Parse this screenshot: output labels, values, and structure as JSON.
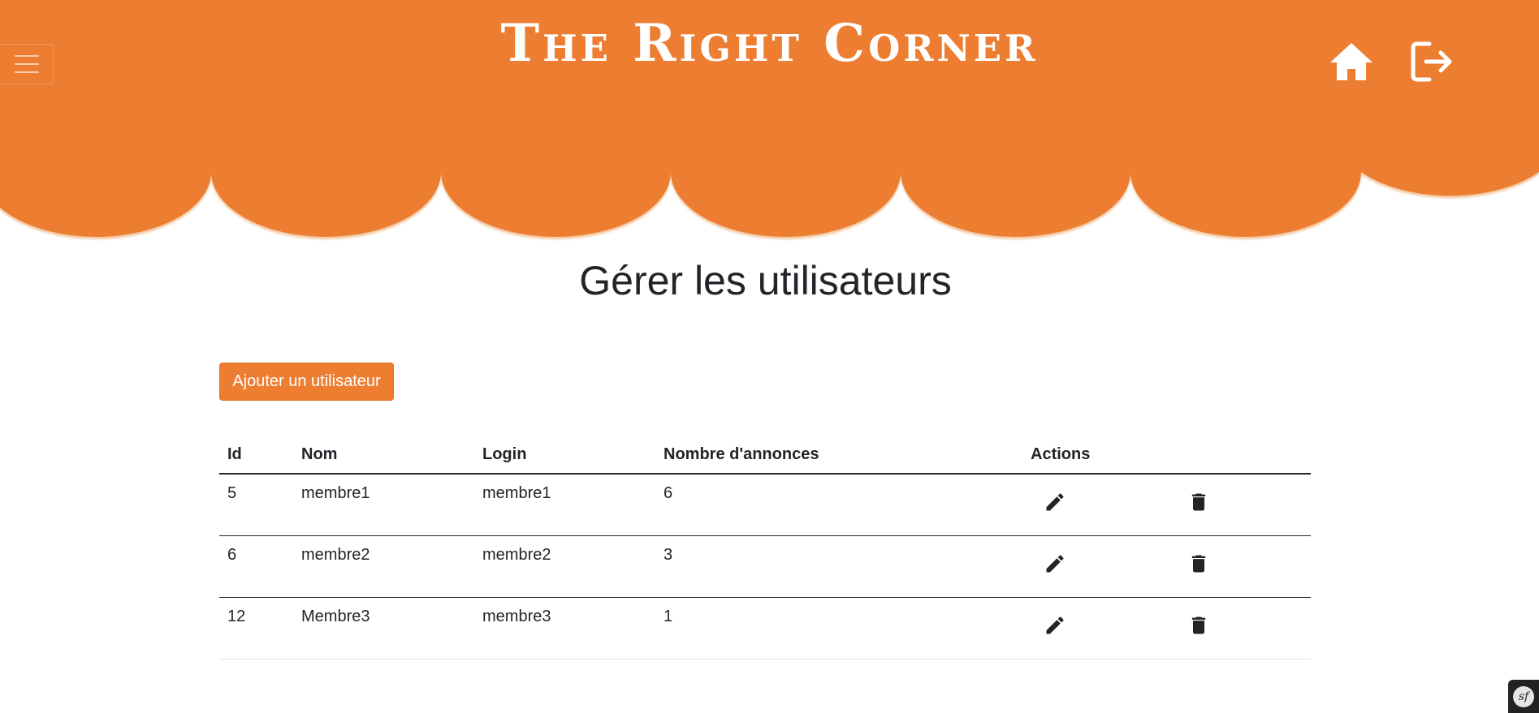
{
  "header": {
    "site_title": "The Right Corner",
    "menu_icon": "hamburger-menu-icon",
    "home_icon": "home-icon",
    "logout_icon": "logout-icon",
    "brand_color": "#ed7d31"
  },
  "main": {
    "page_title": "Gérer les utilisateurs",
    "add_button_label": "Ajouter un utilisateur",
    "table": {
      "headers": [
        "Id",
        "Nom",
        "Login",
        "Nombre d'annonces",
        "Actions"
      ],
      "rows": [
        {
          "id": "5",
          "nom": "membre1",
          "login": "membre1",
          "annonces": "6"
        },
        {
          "id": "6",
          "nom": "membre2",
          "login": "membre2",
          "annonces": "3"
        },
        {
          "id": "12",
          "nom": "Membre3",
          "login": "membre3",
          "annonces": "1"
        }
      ],
      "edit_icon": "pencil-icon",
      "delete_icon": "trash-icon"
    }
  },
  "debug_toolbar": {
    "icon": "symfony-logo-icon",
    "label": "sf"
  }
}
